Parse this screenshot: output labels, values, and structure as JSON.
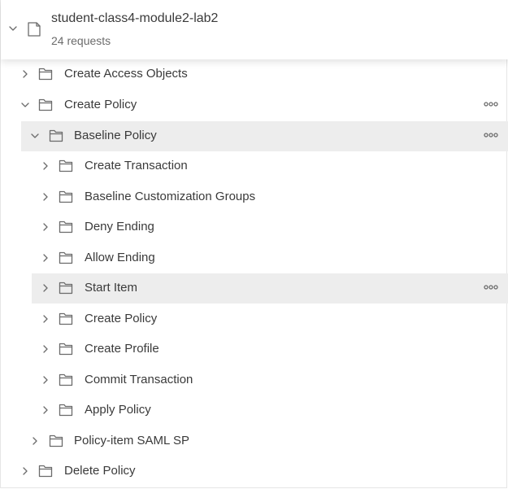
{
  "collection": {
    "name": "student-class4-module2-lab2",
    "request_count": "24 requests"
  },
  "tree": {
    "items": [
      {
        "label": "Create Access Objects",
        "expanded": false,
        "more": false
      },
      {
        "label": "Create Policy",
        "expanded": true,
        "more": true
      },
      {
        "label": "Baseline Policy",
        "expanded": true,
        "more": true
      },
      {
        "label": "Create Transaction",
        "expanded": false,
        "more": false
      },
      {
        "label": "Baseline Customization Groups",
        "expanded": false,
        "more": false
      },
      {
        "label": "Deny Ending",
        "expanded": false,
        "more": false
      },
      {
        "label": "Allow Ending",
        "expanded": false,
        "more": false
      },
      {
        "label": "Start Item",
        "expanded": false,
        "more": true
      },
      {
        "label": "Create Policy",
        "expanded": false,
        "more": false
      },
      {
        "label": "Create Profile",
        "expanded": false,
        "more": false
      },
      {
        "label": "Commit Transaction",
        "expanded": false,
        "more": false
      },
      {
        "label": "Apply Policy",
        "expanded": false,
        "more": false
      },
      {
        "label": "Policy-item SAML SP",
        "expanded": false,
        "more": false
      },
      {
        "label": "Delete Policy",
        "expanded": false,
        "more": false
      }
    ]
  },
  "icons": {
    "collapsed": "chevron-right-icon",
    "expanded": "chevron-down-icon",
    "folder": "folder-icon",
    "collection": "collection-icon",
    "more": "more-options-icon"
  },
  "colors": {
    "text": "#3a3a3a",
    "subtext": "#6b6b6b",
    "row_highlight": "#ededed"
  }
}
